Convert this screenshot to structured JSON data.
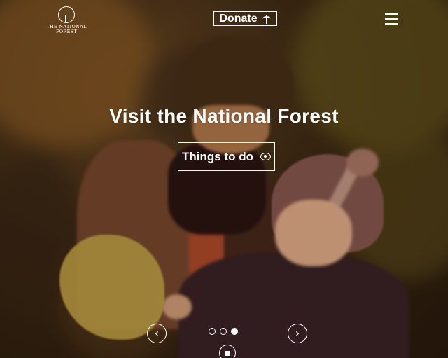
{
  "header": {
    "logo_line1": "THE NATIONAL",
    "logo_line2": "FOREST",
    "logo_icon": "tree-logo-icon",
    "donate_label": "Donate",
    "donate_icon": "sprout-icon",
    "menu_icon": "hamburger-menu-icon"
  },
  "hero": {
    "headline": "Visit the National Forest",
    "cta_label": "Things to do",
    "cta_icon": "eye-icon"
  },
  "carousel": {
    "prev_icon": "chevron-left-icon",
    "next_icon": "chevron-right-icon",
    "prev_glyph": "‹",
    "next_glyph": "›",
    "slide_count": 3,
    "active_slide": 3,
    "pause_icon": "stop-icon"
  },
  "colors": {
    "foreground": "#ffffff"
  }
}
